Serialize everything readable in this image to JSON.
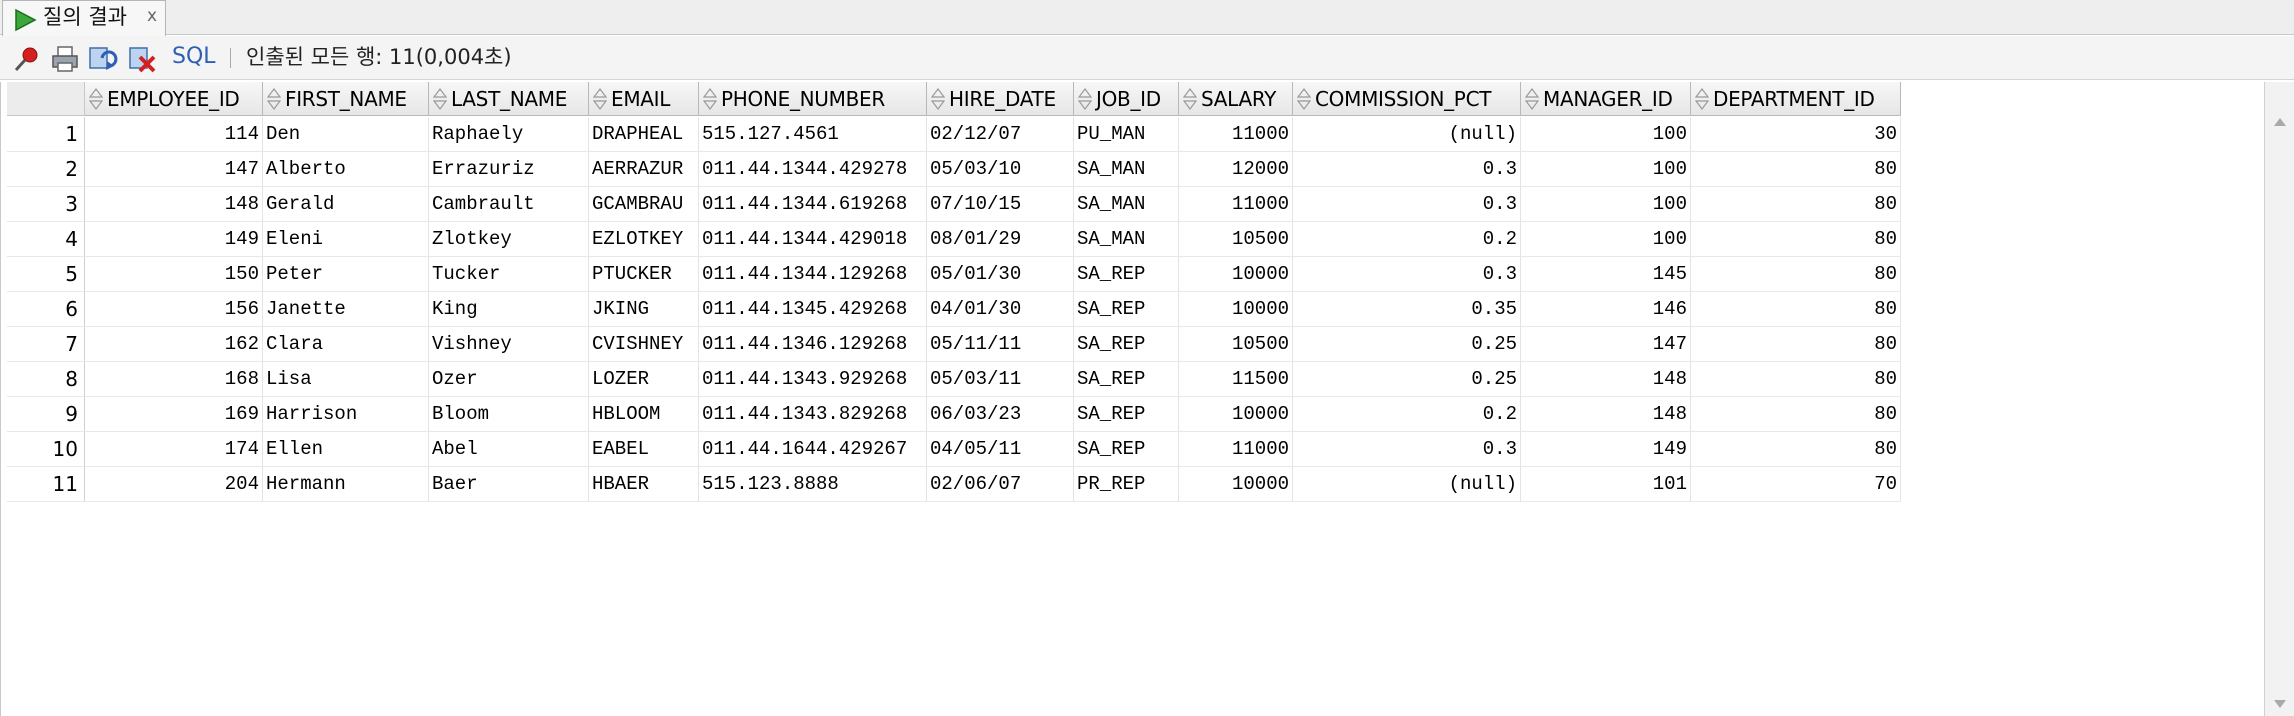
{
  "tab": {
    "title": "질의 결과",
    "close": "x"
  },
  "toolbar": {
    "sql_label": "SQL",
    "status": "인출된 모든 행: 11(0,004초)",
    "icons": [
      "pin-icon",
      "print-icon",
      "refresh-icon",
      "cancel-icon"
    ]
  },
  "grid": {
    "columns": [
      "EMPLOYEE_ID",
      "FIRST_NAME",
      "LAST_NAME",
      "EMAIL",
      "PHONE_NUMBER",
      "HIRE_DATE",
      "JOB_ID",
      "SALARY",
      "COMMISSION_PCT",
      "MANAGER_ID",
      "DEPARTMENT_ID"
    ],
    "rows": [
      [
        "1",
        "114",
        "Den",
        "Raphaely",
        "DRAPHEAL",
        "515.127.4561",
        "02/12/07",
        "PU_MAN",
        "11000",
        "(null)",
        "100",
        "30"
      ],
      [
        "2",
        "147",
        "Alberto",
        "Errazuriz",
        "AERRAZUR",
        "011.44.1344.429278",
        "05/03/10",
        "SA_MAN",
        "12000",
        "0.3",
        "100",
        "80"
      ],
      [
        "3",
        "148",
        "Gerald",
        "Cambrault",
        "GCAMBRAU",
        "011.44.1344.619268",
        "07/10/15",
        "SA_MAN",
        "11000",
        "0.3",
        "100",
        "80"
      ],
      [
        "4",
        "149",
        "Eleni",
        "Zlotkey",
        "EZLOTKEY",
        "011.44.1344.429018",
        "08/01/29",
        "SA_MAN",
        "10500",
        "0.2",
        "100",
        "80"
      ],
      [
        "5",
        "150",
        "Peter",
        "Tucker",
        "PTUCKER",
        "011.44.1344.129268",
        "05/01/30",
        "SA_REP",
        "10000",
        "0.3",
        "145",
        "80"
      ],
      [
        "6",
        "156",
        "Janette",
        "King",
        "JKING",
        "011.44.1345.429268",
        "04/01/30",
        "SA_REP",
        "10000",
        "0.35",
        "146",
        "80"
      ],
      [
        "7",
        "162",
        "Clara",
        "Vishney",
        "CVISHNEY",
        "011.44.1346.129268",
        "05/11/11",
        "SA_REP",
        "10500",
        "0.25",
        "147",
        "80"
      ],
      [
        "8",
        "168",
        "Lisa",
        "Ozer",
        "LOZER",
        "011.44.1343.929268",
        "05/03/11",
        "SA_REP",
        "11500",
        "0.25",
        "148",
        "80"
      ],
      [
        "9",
        "169",
        "Harrison",
        "Bloom",
        "HBLOOM",
        "011.44.1343.829268",
        "06/03/23",
        "SA_REP",
        "10000",
        "0.2",
        "148",
        "80"
      ],
      [
        "10",
        "174",
        "Ellen",
        "Abel",
        "EABEL",
        "011.44.1644.429267",
        "04/05/11",
        "SA_REP",
        "11000",
        "0.3",
        "149",
        "80"
      ],
      [
        "11",
        "204",
        "Hermann",
        "Baer",
        "HBAER",
        "515.123.8888",
        "02/06/07",
        "PR_REP",
        "10000",
        "(null)",
        "101",
        "70"
      ]
    ]
  }
}
